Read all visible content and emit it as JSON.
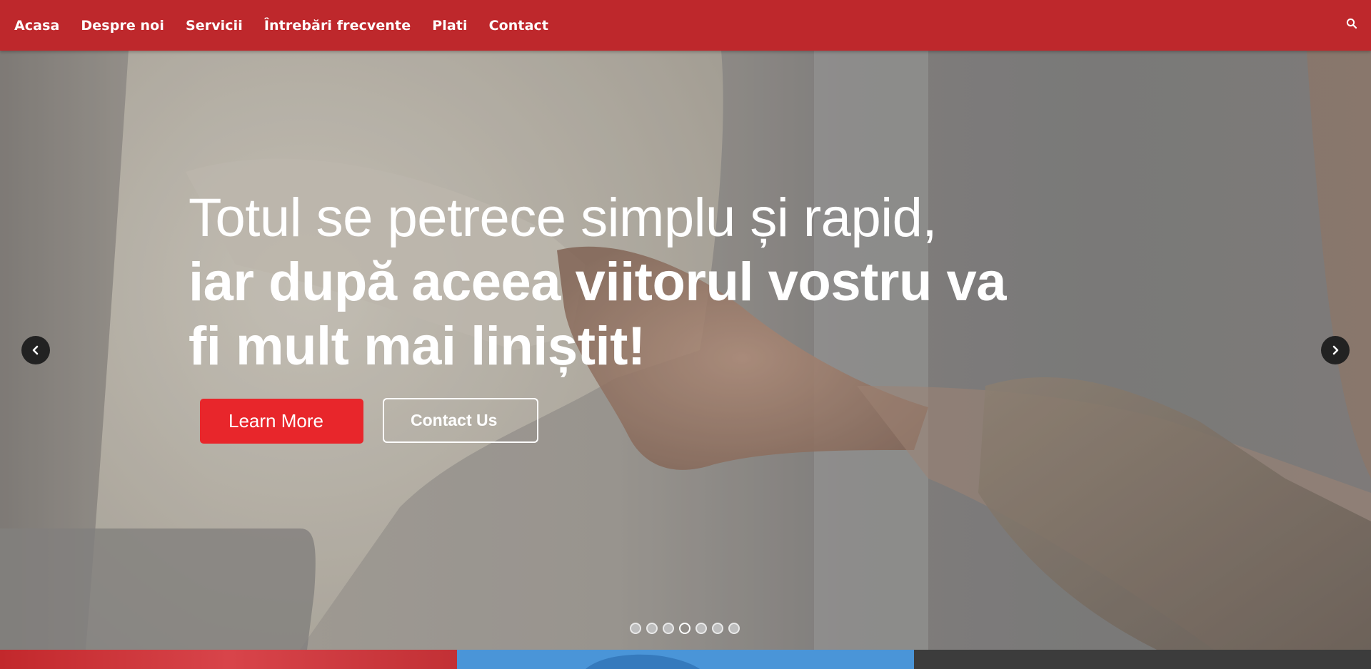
{
  "nav": {
    "items": [
      {
        "label": "Acasa"
      },
      {
        "label": "Despre noi"
      },
      {
        "label": "Servicii"
      },
      {
        "label": "Întrebări frecvente"
      },
      {
        "label": "Plati"
      },
      {
        "label": "Contact"
      }
    ],
    "search_icon": "search-icon"
  },
  "hero": {
    "line1": "Totul se petrece simplu și rapid,",
    "line2": "iar după aceea viitorul vostru va",
    "line3": "fi mult mai liniștit!",
    "learn_more": "Learn More",
    "contact_us": "Contact Us",
    "prev_icon": "chevron-left-icon",
    "next_icon": "chevron-right-icon",
    "slide_count": 7,
    "active_slide": 4
  },
  "colors": {
    "nav_bg": "#be282c",
    "button_red": "#e8262b",
    "strip_blue": "#4a95d8",
    "strip_dark": "#3c3c3c"
  }
}
